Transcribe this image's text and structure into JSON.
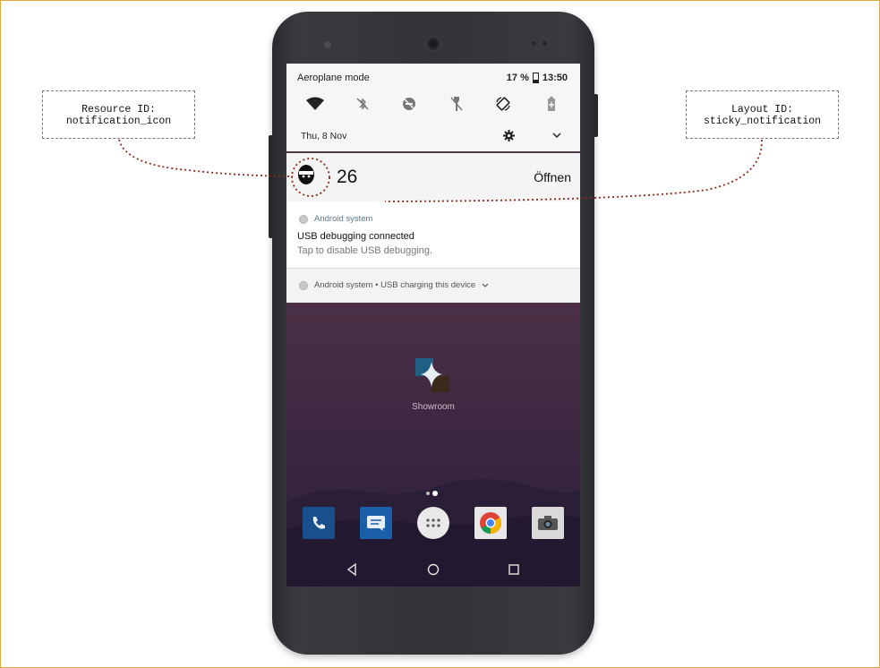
{
  "callouts": {
    "left": {
      "line1": "Resource ID:",
      "line2": "notification_icon"
    },
    "right": {
      "line1": "Layout ID:",
      "line2": "sticky_notification"
    }
  },
  "status": {
    "mode": "Aeroplane mode",
    "battery": "17 %",
    "time": "13:50"
  },
  "quick_settings": {
    "tiles": [
      "wifi-icon",
      "bluetooth-off-icon",
      "do-not-disturb-off-icon",
      "flashlight-off-icon",
      "auto-rotate-icon",
      "battery-saver-icon"
    ],
    "date": "Thu, 8 Nov"
  },
  "sticky_notification": {
    "count": "26",
    "action": "Öffnen"
  },
  "notification": {
    "app": "Android system",
    "title": "USB debugging connected",
    "text": "Tap to disable USB debugging."
  },
  "notification2": {
    "text": "Android system • USB charging this device"
  },
  "home": {
    "app_label": "Showroom",
    "dock": [
      "phone-icon",
      "messages-icon",
      "app-drawer-icon",
      "chrome-icon",
      "camera-icon"
    ]
  },
  "colors": {
    "accent_dotted": "#8b2a1a",
    "frame": "#e0a93a"
  }
}
